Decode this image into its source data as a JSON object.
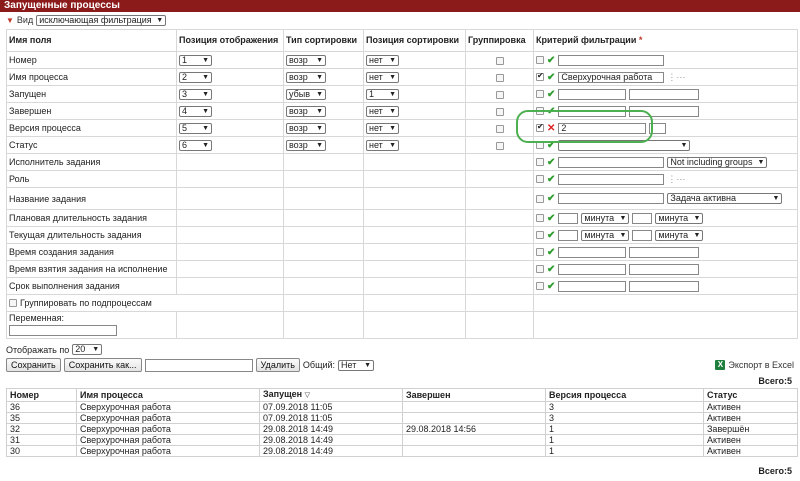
{
  "title": "Запущенные процессы",
  "view": {
    "label": "Вид",
    "value": "исключающая фильтрация"
  },
  "headers": {
    "field": "Имя поля",
    "display_pos": "Позиция отображения",
    "sort_type": "Тип сортировки",
    "sort_pos": "Позиция сортировки",
    "grouping": "Группировка",
    "filter": "Критерий фильтрации",
    "required_mark": "*"
  },
  "rows": [
    {
      "name": "Номер",
      "display_pos": "1",
      "sort_type": "возр",
      "sort_pos": "нет",
      "filter_checked": false,
      "filter_text": ""
    },
    {
      "name": "Имя процесса",
      "display_pos": "2",
      "sort_type": "возр",
      "sort_pos": "нет",
      "filter_checked": true,
      "filter_text": "Сверхурочная работа"
    },
    {
      "name": "Запущен",
      "display_pos": "3",
      "sort_type": "убыв",
      "sort_pos": "1",
      "filter_checked": false,
      "filter_text": ""
    },
    {
      "name": "Завершен",
      "display_pos": "4",
      "sort_type": "возр",
      "sort_pos": "нет",
      "filter_checked": false,
      "filter_text": ""
    },
    {
      "name": "Версия процесса",
      "display_pos": "5",
      "sort_type": "возр",
      "sort_pos": "нет",
      "filter_checked": true,
      "filter_text": "2"
    },
    {
      "name": "Статус",
      "display_pos": "6",
      "sort_type": "возр",
      "sort_pos": "нет",
      "filter_checked": false,
      "filter_text": ""
    },
    {
      "name": "Исполнитель задания",
      "filter_select": "Not including groups"
    },
    {
      "name": "Роль"
    },
    {
      "name": "Название задания",
      "filter_select": "Задача активна"
    },
    {
      "name": "Плановая длительность задания",
      "unit1": "минута",
      "unit2": "минута"
    },
    {
      "name": "Текущая длительность задания",
      "unit1": "минута",
      "unit2": "минута"
    },
    {
      "name": "Время создания задания"
    },
    {
      "name": "Время взятия задания на исполнение"
    },
    {
      "name": "Срок выполнения задания"
    }
  ],
  "group_by_subprocess": "Группировать по подпроцессам",
  "variable_label": "Переменная:",
  "show_by": {
    "label": "Отображать по",
    "value": "20"
  },
  "buttons": {
    "save": "Сохранить",
    "save_as": "Сохранить как...",
    "delete": "Удалить",
    "shared_label": "Общий:",
    "shared_value": "Нет",
    "export": "Экспорт в Excel"
  },
  "total_text": "Всего:5",
  "results": {
    "columns": [
      "Номер",
      "Имя процесса",
      "Запущен",
      "Завершен",
      "Версия процесса",
      "Статус"
    ],
    "rows": [
      [
        "36",
        "Сверхурочная работа",
        "07.09.2018 11:05",
        "",
        "3",
        "Активен"
      ],
      [
        "35",
        "Сверхурочная работа",
        "07.09.2018 11:05",
        "",
        "3",
        "Активен"
      ],
      [
        "32",
        "Сверхурочная работа",
        "29.08.2018 14:49",
        "29.08.2018 14:56",
        "1",
        "Завершён"
      ],
      [
        "31",
        "Сверхурочная работа",
        "29.08.2018 14:49",
        "",
        "1",
        "Активен"
      ],
      [
        "30",
        "Сверхурочная работа",
        "29.08.2018 14:49",
        "",
        "1",
        "Активен"
      ]
    ]
  }
}
